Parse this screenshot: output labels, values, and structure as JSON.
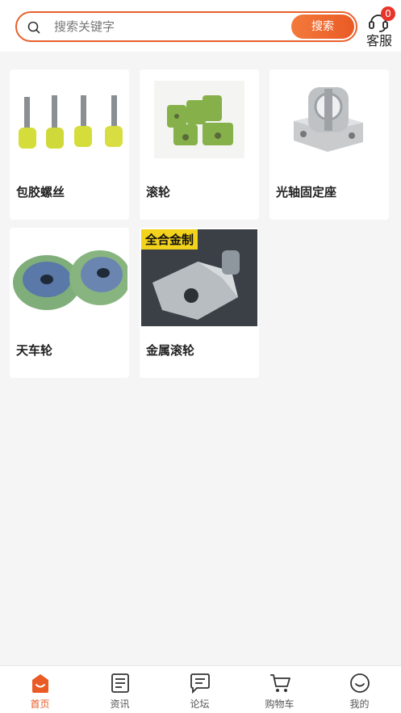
{
  "search": {
    "placeholder": "搜索关键字",
    "value": "",
    "button_label": "搜索"
  },
  "customer_service": {
    "label": "客服",
    "badge": "0"
  },
  "products": [
    {
      "name": "包胶螺丝",
      "image": "coated-screws"
    },
    {
      "name": "滚轮",
      "image": "rollers"
    },
    {
      "name": "光轴固定座",
      "image": "shaft-support"
    },
    {
      "name": "天车轮",
      "image": "crane-wheels"
    },
    {
      "name": "金属滚轮",
      "image": "metal-roller-bracket",
      "image_caption": "全合金制"
    }
  ],
  "tabbar": {
    "items": [
      {
        "label": "首页",
        "icon": "home-icon",
        "active": true
      },
      {
        "label": "资讯",
        "icon": "news-icon",
        "active": false
      },
      {
        "label": "论坛",
        "icon": "forum-icon",
        "active": false
      },
      {
        "label": "购物车",
        "icon": "cart-icon",
        "active": false
      },
      {
        "label": "我的",
        "icon": "profile-icon",
        "active": false
      }
    ]
  },
  "colors": {
    "accent": "#ea5a25",
    "badge": "#e8332a",
    "background": "#f5f5f5"
  }
}
